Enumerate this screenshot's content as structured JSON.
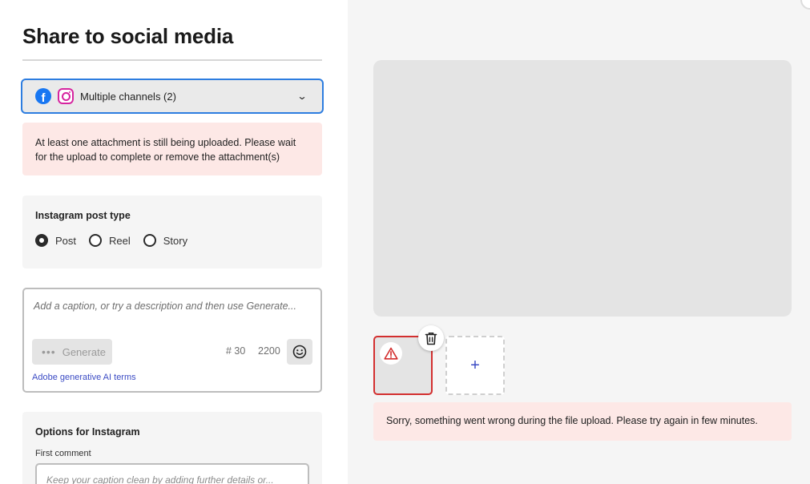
{
  "page": {
    "title": "Share to social media"
  },
  "channels": {
    "label": "Multiple channels (2)",
    "icons": [
      "facebook-icon",
      "instagram-icon"
    ]
  },
  "upload_warning": {
    "line1": "At least one attachment is still being uploaded. Please wait",
    "line2": "for the upload to complete or remove the attachment(s)"
  },
  "post_type": {
    "heading": "Instagram post type",
    "options": [
      "Post",
      "Reel",
      "Story"
    ],
    "selected": "Post"
  },
  "caption": {
    "placeholder": "Add a caption, or try a description and then use Generate...",
    "generate_label": "Generate",
    "hashtag_count": "# 30",
    "char_count": "2200",
    "ai_terms_link": "Adobe generative AI terms"
  },
  "options": {
    "heading": "Options for Instagram",
    "first_comment_label": "First comment",
    "first_comment_placeholder": "Keep your caption clean by adding further details or..."
  },
  "media": {
    "add_symbol": "+",
    "error_message": "Sorry, something went wrong during the file upload. Please try again in few minutes."
  },
  "colors": {
    "accent": "#2d7de0",
    "error": "#d32f2f",
    "error_bg": "#fde8e6",
    "link": "#3b4bc4"
  }
}
